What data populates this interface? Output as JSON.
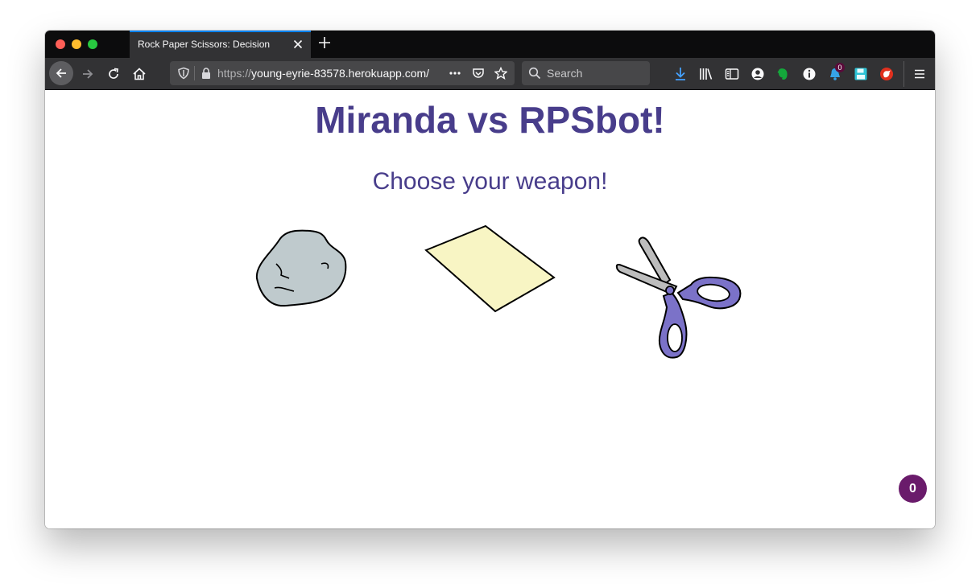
{
  "browser": {
    "tab_title": "Rock Paper Scissors: Decision",
    "url_protocol": "https://",
    "url_host": "young-eyrie-83578.herokuapp.com/",
    "search_placeholder": "Search",
    "notification_count": "0"
  },
  "page": {
    "title": "Miranda vs RPSbot!",
    "subtitle": "Choose your weapon!",
    "weapons": [
      "rock",
      "paper",
      "scissors"
    ],
    "floating_badge": "0"
  },
  "colors": {
    "heading": "#483d8b",
    "rock_fill": "#bfcacd",
    "paper_fill": "#f8f5c4",
    "scissors_handle": "#7b72c8",
    "badge": "#6a1b6b",
    "tab_accent": "#0a84ff"
  }
}
